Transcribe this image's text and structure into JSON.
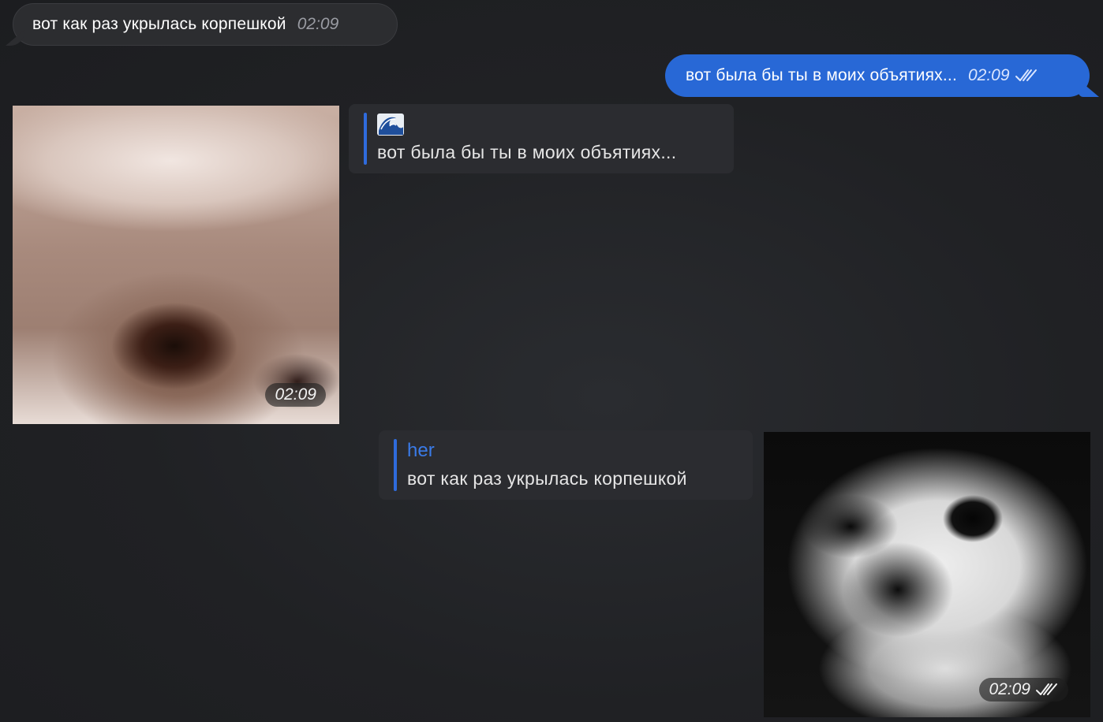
{
  "messages": {
    "incoming_1": {
      "text": "вот как раз укрылась корпешкой",
      "time": "02:09"
    },
    "outgoing_1": {
      "text": "вот была бы ты в моих объятиях...",
      "time": "02:09",
      "status_icon": "double-check-icon"
    },
    "media_1": {
      "time": "02:09",
      "description_icon": "sticker-image"
    },
    "reply_1": {
      "emoji": "🌊",
      "text": "вот была бы ты в моих объятиях..."
    },
    "reply_2": {
      "sender": "her",
      "text": "вот как раз укрылась корпешкой"
    },
    "media_2": {
      "time": "02:09",
      "status_icon": "double-check-icon"
    }
  },
  "colors": {
    "background": "#202124",
    "incoming_bubble": "#2c2d30",
    "outgoing_bubble": "#2868d6",
    "reply_accent": "#2f6bdc",
    "sender_name": "#3a7be8"
  }
}
